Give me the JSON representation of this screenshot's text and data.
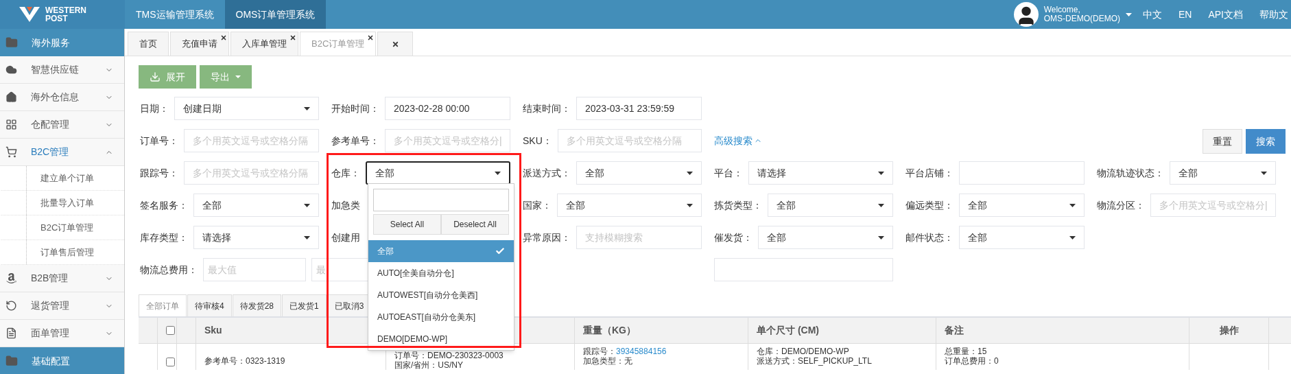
{
  "header": {
    "logo": {
      "line1": "WESTERN",
      "line2": "POST"
    },
    "systems": [
      {
        "label": "TMS运输管理系统",
        "selected": false
      },
      {
        "label": "OMS订单管理系统",
        "selected": true
      }
    ],
    "user": {
      "greeting": "Welcome,",
      "name": "OMS-DEMO(DEMO)"
    },
    "links": [
      "中文",
      "EN",
      "API文档",
      "帮助文"
    ]
  },
  "sidebar": {
    "items": [
      {
        "kind": "header",
        "label": "海外服务"
      },
      {
        "kind": "menu",
        "label": "智慧供应链",
        "expanded": false
      },
      {
        "kind": "menu",
        "label": "海外仓信息",
        "expanded": false
      },
      {
        "kind": "menu",
        "label": "仓配管理",
        "expanded": false
      },
      {
        "kind": "menu",
        "label": "B2C管理",
        "expanded": true,
        "children": [
          {
            "label": "建立单个订单"
          },
          {
            "label": "批量导入订单"
          },
          {
            "label": "B2C订单管理"
          },
          {
            "label": "订单售后管理"
          }
        ]
      },
      {
        "kind": "menu",
        "label": "B2B管理",
        "expanded": false
      },
      {
        "kind": "menu",
        "label": "退货管理",
        "expanded": false
      },
      {
        "kind": "menu",
        "label": "面单管理",
        "expanded": false
      },
      {
        "kind": "header",
        "label": "基础配置"
      }
    ]
  },
  "page_tabs": [
    {
      "kind": "tab",
      "label": "首页",
      "closable": false,
      "selected": false
    },
    {
      "kind": "tab",
      "label": "充值申请",
      "closable": true,
      "selected": false
    },
    {
      "kind": "tab",
      "label": "入库单管理",
      "closable": true,
      "selected": false
    },
    {
      "kind": "tab",
      "label": "B2C订单管理",
      "closable": true,
      "selected": true
    },
    {
      "kind": "close_all"
    }
  ],
  "toolbar": [
    {
      "kind": "expand",
      "label": "展开"
    },
    {
      "kind": "dropdown",
      "label": "导出"
    }
  ],
  "filters": {
    "rows": [
      [
        {
          "kind": "select",
          "label": "日期：",
          "value": "创建日期"
        },
        {
          "kind": "input",
          "label": "开始时间：",
          "value": "2023-02-28 00:00"
        },
        {
          "kind": "input",
          "label": "结束时间：",
          "value": "2023-03-31 23:59:59"
        }
      ],
      [
        {
          "kind": "input",
          "label": "订单号：",
          "placeholder": "多个用英文逗号或空格分隔"
        },
        {
          "kind": "input",
          "label": "参考单号：",
          "placeholder": "多个用英文逗号或空格分|"
        },
        {
          "kind": "input",
          "label": "SKU：",
          "placeholder": "多个用英文逗号或空格分隔"
        }
      ],
      [
        {
          "kind": "input",
          "label": "跟踪号：",
          "placeholder": "多个用英文逗号或空格分隔"
        },
        {
          "kind": "select",
          "label": "仓库：",
          "value": "全部",
          "focused": true
        },
        {
          "kind": "select",
          "label": "派送方式：",
          "value": "全部"
        },
        {
          "kind": "select",
          "label": "平台：",
          "value": "请选择"
        },
        {
          "kind": "input",
          "label": "平台店铺："
        },
        {
          "kind": "select",
          "label": "物流轨迹状态：",
          "value": "全部"
        }
      ],
      [
        {
          "kind": "select",
          "label": "签名服务：",
          "value": "全部"
        },
        {
          "kind": "label_only",
          "label": "加急类"
        },
        {
          "kind": "select",
          "label": "国家：",
          "value": "全部"
        },
        {
          "kind": "select",
          "label": "拣货类型：",
          "value": "全部"
        },
        {
          "kind": "select",
          "label": "偏远类型：",
          "value": "全部"
        },
        {
          "kind": "input",
          "label": "物流分区：",
          "placeholder": "多个用英文逗号或空格分|"
        }
      ],
      [
        {
          "kind": "select",
          "label": "库存类型：",
          "value": "请选择"
        },
        {
          "kind": "label_only",
          "label": "创建用"
        },
        {
          "kind": "input",
          "label": "异常原因：",
          "placeholder": "支持模糊搜索"
        },
        {
          "kind": "select",
          "label": "催发货：",
          "value": "全部"
        },
        {
          "kind": "select",
          "label": "邮件状态：",
          "value": "全部"
        }
      ],
      [
        {
          "kind": "range",
          "label": "物流总费用：",
          "placeholders": [
            "最大值",
            "最"
          ]
        },
        {
          "kind": "blank"
        },
        {
          "kind": "input"
        }
      ]
    ],
    "advanced": {
      "label": "高级搜索",
      "expanded": true
    },
    "actions": [
      {
        "kind": "reset",
        "label": "重置"
      },
      {
        "kind": "search",
        "label": "搜索"
      }
    ]
  },
  "warehouse_dropdown": {
    "buttons": [
      "Select All",
      "Deselect All"
    ],
    "options": [
      {
        "label": "全部",
        "selected": true
      },
      {
        "label": "AUTO[全美自动分仓]",
        "selected": false
      },
      {
        "label": "AUTOWEST[自动分仓美西]",
        "selected": false
      },
      {
        "label": "AUTOEAST[自动分仓美东]",
        "selected": false
      },
      {
        "label": "DEMO[DEMO-WP]",
        "selected": false
      }
    ]
  },
  "annotation_box": true,
  "status_tabs": [
    {
      "label": "全部订单",
      "selected": true
    },
    {
      "label": "待审核4",
      "selected": false
    },
    {
      "label": "待发货28",
      "selected": false
    },
    {
      "label": "已发货1",
      "selected": false
    },
    {
      "label": "已取消3",
      "selected": false
    }
  ],
  "table": {
    "columns": [
      {
        "kind": "blank"
      },
      {
        "kind": "checkbox",
        "checked": false
      },
      {
        "kind": "blank"
      },
      {
        "kind": "text",
        "label": "Sku"
      },
      {
        "kind": "blank"
      },
      {
        "kind": "text",
        "label": "重量（KG）"
      },
      {
        "kind": "text",
        "label": "单个尺寸 (CM)"
      },
      {
        "kind": "text",
        "label": "备注"
      },
      {
        "kind": "text",
        "label": "操作"
      }
    ],
    "rows": [
      {
        "checked": false,
        "cells": [
          [],
          [],
          [],
          [
            {
              "kind": "text",
              "text": "参考单号：0323-1319"
            }
          ],
          [
            {
              "kind": "text",
              "text": "订单号：DEMO-230323-0003"
            },
            {
              "kind": "text",
              "text": "国家/省州：US/NY"
            }
          ],
          [
            {
              "kind": "link",
              "text": "跟踪号：",
              "link": "39345884156"
            },
            {
              "kind": "text",
              "text": "加急类型：无"
            }
          ],
          [
            {
              "kind": "text",
              "text": "仓库：DEMO/DEMO-WP"
            },
            {
              "kind": "text",
              "text": "派送方式：SELF_PICKUP_LTL"
            }
          ],
          [
            {
              "kind": "text",
              "text": "总重量：15"
            },
            {
              "kind": "text",
              "text": "订单总费用：0"
            }
          ],
          []
        ]
      }
    ]
  }
}
